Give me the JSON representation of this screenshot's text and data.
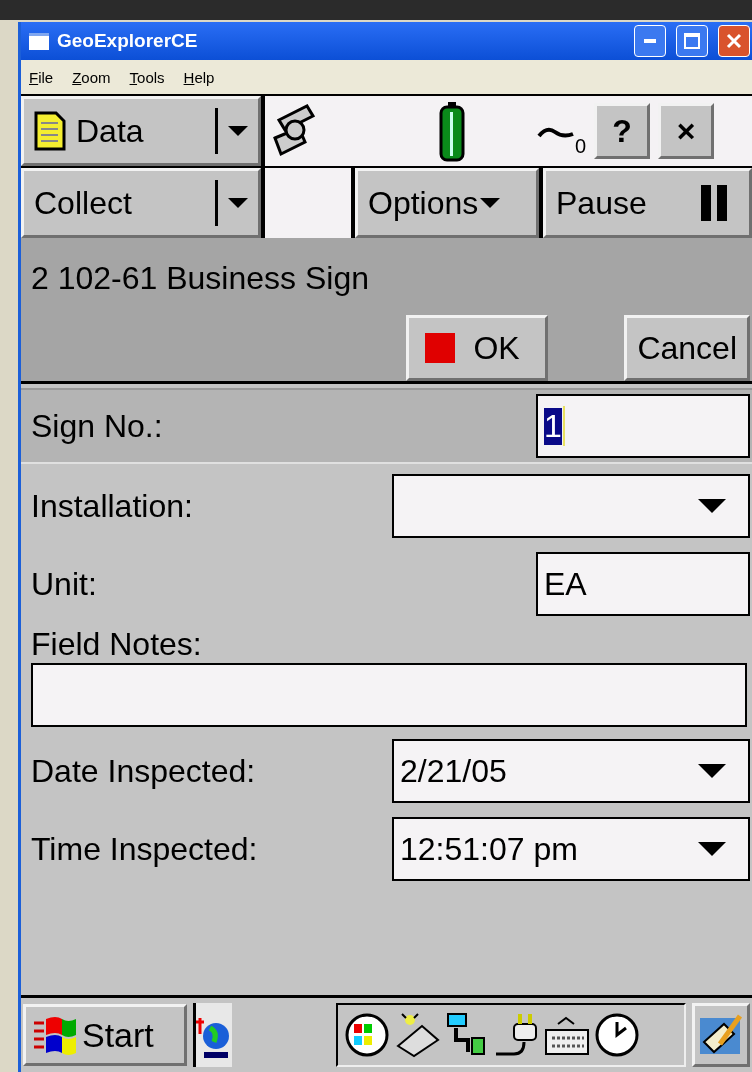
{
  "window": {
    "title": "GeoExplorerCE"
  },
  "menu": [
    "File",
    "Zoom",
    "Tools",
    "Help"
  ],
  "toolbar": {
    "data_button": "Data",
    "satellite_count": "0",
    "help_button": "?",
    "close_button": "×"
  },
  "command_bar": {
    "collect_button": "Collect",
    "options_button": "Options",
    "pause_button": "Pause"
  },
  "form": {
    "title": "2 102-61 Business Sign",
    "ok_button": "OK",
    "cancel_button": "Cancel",
    "fields": [
      {
        "kind": "text",
        "label": "Sign No.:",
        "value": "1",
        "selected": true
      },
      {
        "kind": "dropdown",
        "label": "Installation:",
        "selected": false
      },
      {
        "kind": "text",
        "label": "Unit:",
        "value": "EA",
        "selected": false
      },
      {
        "kind": "textarea",
        "label": "Field Notes:",
        "selected": false
      },
      {
        "kind": "dropdown",
        "label": "Date Inspected:",
        "value": "2/21/05",
        "selected": false
      },
      {
        "kind": "dropdown",
        "label": "Time Inspected:",
        "value": "12:51:07 pm",
        "selected": false
      }
    ]
  },
  "taskbar": {
    "start_button": "Start"
  }
}
